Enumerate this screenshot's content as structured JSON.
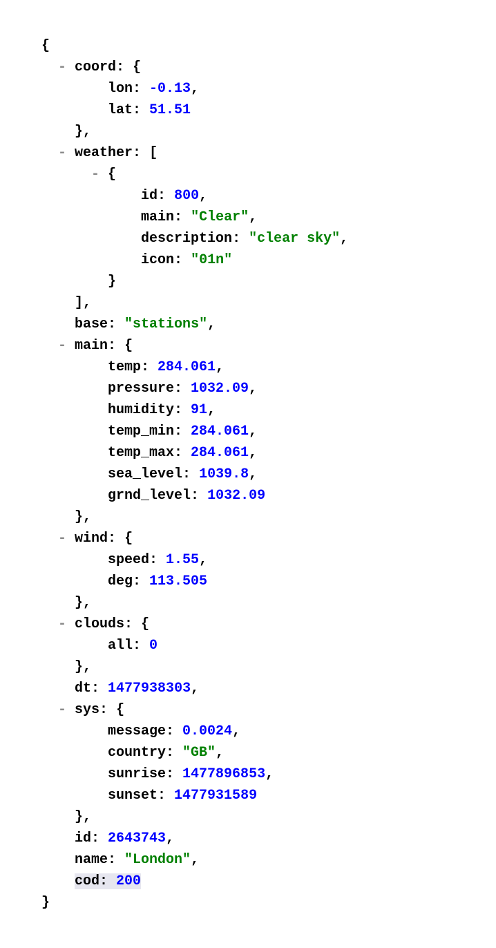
{
  "punct": {
    "brace_open": "{",
    "brace_close": "}",
    "bracket_open": "[",
    "bracket_close": "]",
    "comma": ",",
    "colon": ": ",
    "toggle": "- "
  },
  "coord": {
    "label": "coord",
    "lon": {
      "key": "lon",
      "value": "-0.13"
    },
    "lat": {
      "key": "lat",
      "value": "51.51"
    }
  },
  "weather": {
    "label": "weather",
    "item0": {
      "id": {
        "key": "id",
        "value": "800"
      },
      "main": {
        "key": "main",
        "value": "\"Clear\""
      },
      "description": {
        "key": "description",
        "value": "\"clear sky\""
      },
      "icon": {
        "key": "icon",
        "value": "\"01n\""
      }
    }
  },
  "base": {
    "key": "base",
    "value": "\"stations\""
  },
  "main_data": {
    "label": "main",
    "temp": {
      "key": "temp",
      "value": "284.061"
    },
    "pressure": {
      "key": "pressure",
      "value": "1032.09"
    },
    "humidity": {
      "key": "humidity",
      "value": "91"
    },
    "temp_min": {
      "key": "temp_min",
      "value": "284.061"
    },
    "temp_max": {
      "key": "temp_max",
      "value": "284.061"
    },
    "sea_level": {
      "key": "sea_level",
      "value": "1039.8"
    },
    "grnd_level": {
      "key": "grnd_level",
      "value": "1032.09"
    }
  },
  "wind": {
    "label": "wind",
    "speed": {
      "key": "speed",
      "value": "1.55"
    },
    "deg": {
      "key": "deg",
      "value": "113.505"
    }
  },
  "clouds": {
    "label": "clouds",
    "all": {
      "key": "all",
      "value": "0"
    }
  },
  "dt": {
    "key": "dt",
    "value": "1477938303"
  },
  "sys": {
    "label": "sys",
    "message": {
      "key": "message",
      "value": "0.0024"
    },
    "country": {
      "key": "country",
      "value": "\"GB\""
    },
    "sunrise": {
      "key": "sunrise",
      "value": "1477896853"
    },
    "sunset": {
      "key": "sunset",
      "value": "1477931589"
    }
  },
  "id": {
    "key": "id",
    "value": "2643743"
  },
  "name": {
    "key": "name",
    "value": "\"London\""
  },
  "cod": {
    "key": "cod",
    "value": "200"
  }
}
